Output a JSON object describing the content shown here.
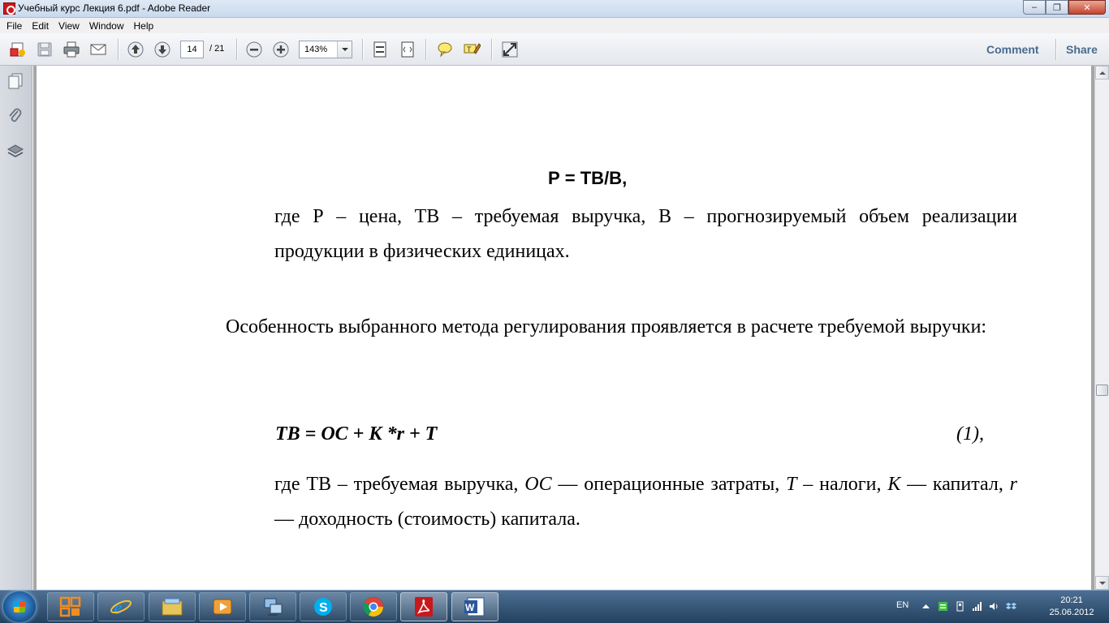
{
  "window": {
    "title": "Учебный курс Лекция 6.pdf - Adobe Reader",
    "minimize": "–",
    "maximize": "❐",
    "close": "✕"
  },
  "menu": [
    "File",
    "Edit",
    "View",
    "Window",
    "Help"
  ],
  "toolbar": {
    "page_current": "14",
    "page_total": "/ 21",
    "zoom": "143%",
    "comment_label": "Comment",
    "share_label": "Share"
  },
  "document": {
    "formula_price": "Р = ТВ/В,",
    "explanation1": "где Р – цена, ТВ – требуемая выручка, В – прогнозируемый объем реализации продукции в физических единицах.",
    "paragraph": "Особенность выбранного метода регулирования проявляется в расчете требуемой выручки:",
    "formula_revenue": "ТВ = ОС + К *r + Т",
    "equation_number": "(1),",
    "explanation2": {
      "part1": "где ТВ – требуемая выручка, ",
      "oc": "ОС",
      "part2": " — операционные затраты, ",
      "t": "Т",
      "part3": " – налоги, ",
      "k": "К",
      "part4": " — капитал, ",
      "r": "r",
      "part5": " — доходность (стоимость) капитала."
    }
  },
  "taskbar": {
    "apps": [
      "file-explorer-icon",
      "internet-explorer-icon",
      "libraries-icon",
      "media-player-icon",
      "network-icon",
      "skype-icon",
      "chrome-icon",
      "adobe-reader-icon",
      "word-icon"
    ],
    "language": "EN",
    "time": "20:21",
    "date": "25.06.2012"
  },
  "colors": {
    "accent_link": "#4a6a8f",
    "adobe_red": "#c8181c",
    "taskbar": "#23415f"
  }
}
